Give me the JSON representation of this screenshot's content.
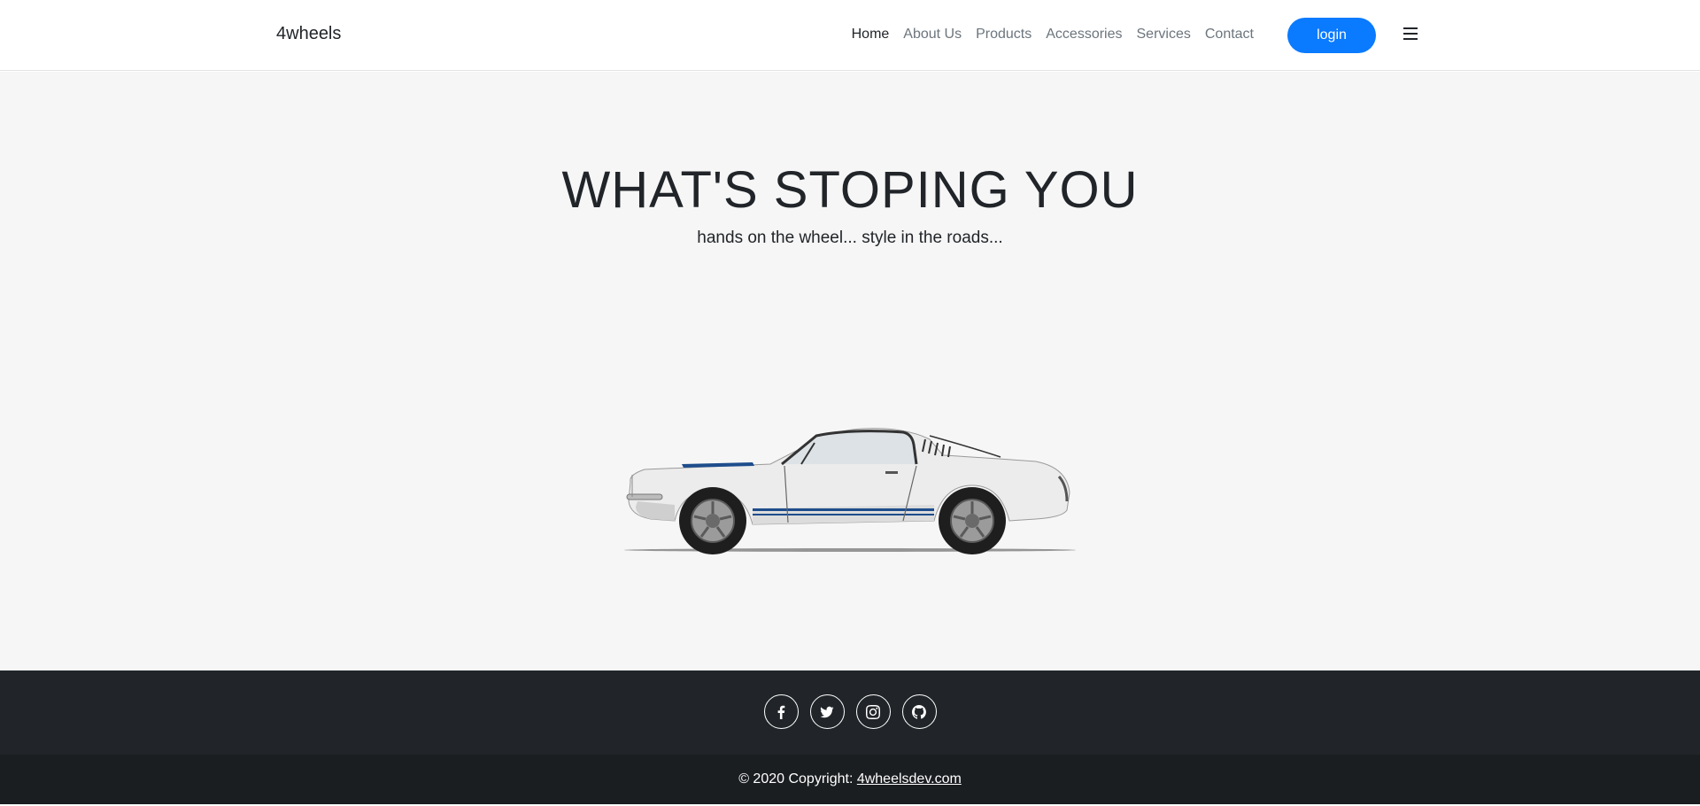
{
  "navbar": {
    "brand": "4wheels",
    "links": [
      {
        "label": "Home",
        "active": true
      },
      {
        "label": "About Us",
        "active": false
      },
      {
        "label": "Products",
        "active": false
      },
      {
        "label": "Accessories",
        "active": false
      },
      {
        "label": "Services",
        "active": false
      },
      {
        "label": "Contact",
        "active": false
      }
    ],
    "login_label": "login",
    "menu_icon": "hamburger-icon"
  },
  "hero": {
    "title": "WHAT'S STOPING YOU",
    "subtitle": "hands on the wheel... style in the roads..."
  },
  "footer": {
    "social": [
      "facebook-icon",
      "twitter-icon",
      "instagram-icon",
      "github-icon"
    ],
    "copyright_prefix": "© 2020 Copyright: ",
    "copyright_link": "4wheelsdev.com"
  },
  "colors": {
    "accent": "#0a7aff",
    "hero_bg": "#f6f6f6",
    "footer_top": "#212529",
    "footer_bottom": "#1b1e21"
  }
}
